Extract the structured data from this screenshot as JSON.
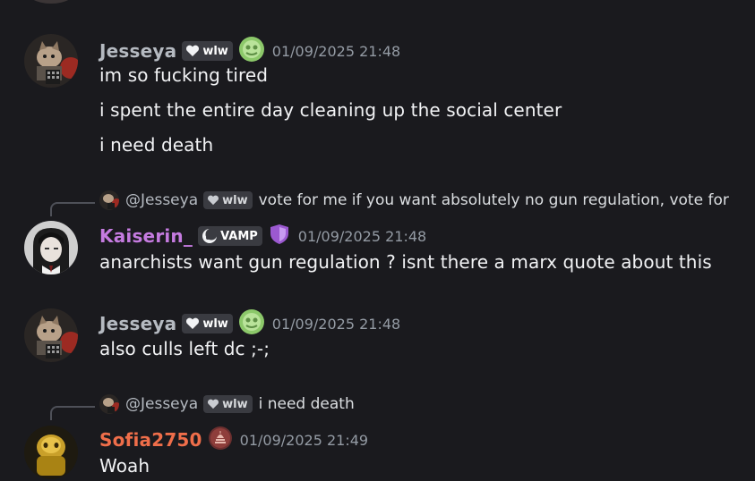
{
  "top_partial": {
    "text": "..."
  },
  "messages": [
    {
      "username": "Jesseya",
      "username_color": "#b5bac1",
      "tag": "wlw",
      "tag_icon": "heart-icon",
      "role_icon": "green-badge-icon",
      "timestamp": "01/09/2025 21:48",
      "lines": [
        "im so fucking tired",
        "i spent the entire day cleaning up the social center",
        "i need death"
      ]
    },
    {
      "reply": {
        "mention": "@Jesseya",
        "tag": "wlw",
        "preview": "vote for me if you want absolutely no gun regulation, vote for"
      },
      "username": "Kaiserin_",
      "username_color": "#c57be0",
      "tag": "VAMP",
      "tag_icon": "moon-icon",
      "role_icon": "shield-icon",
      "timestamp": "01/09/2025 21:48",
      "lines": [
        "anarchists want gun regulation ? isnt there a marx quote about this"
      ]
    },
    {
      "username": "Jesseya",
      "username_color": "#b5bac1",
      "tag": "wlw",
      "tag_icon": "heart-icon",
      "role_icon": "green-badge-icon",
      "timestamp": "01/09/2025 21:48",
      "lines": [
        "also culls left dc ;-;"
      ]
    },
    {
      "reply": {
        "mention": "@Jesseya",
        "tag": "wlw",
        "preview": "i need death"
      },
      "username": "Sofia2750",
      "username_color": "#ef6e4a",
      "role_icon": "capitol-icon",
      "timestamp": "01/09/2025 21:49",
      "lines": [
        "Woah"
      ]
    }
  ]
}
